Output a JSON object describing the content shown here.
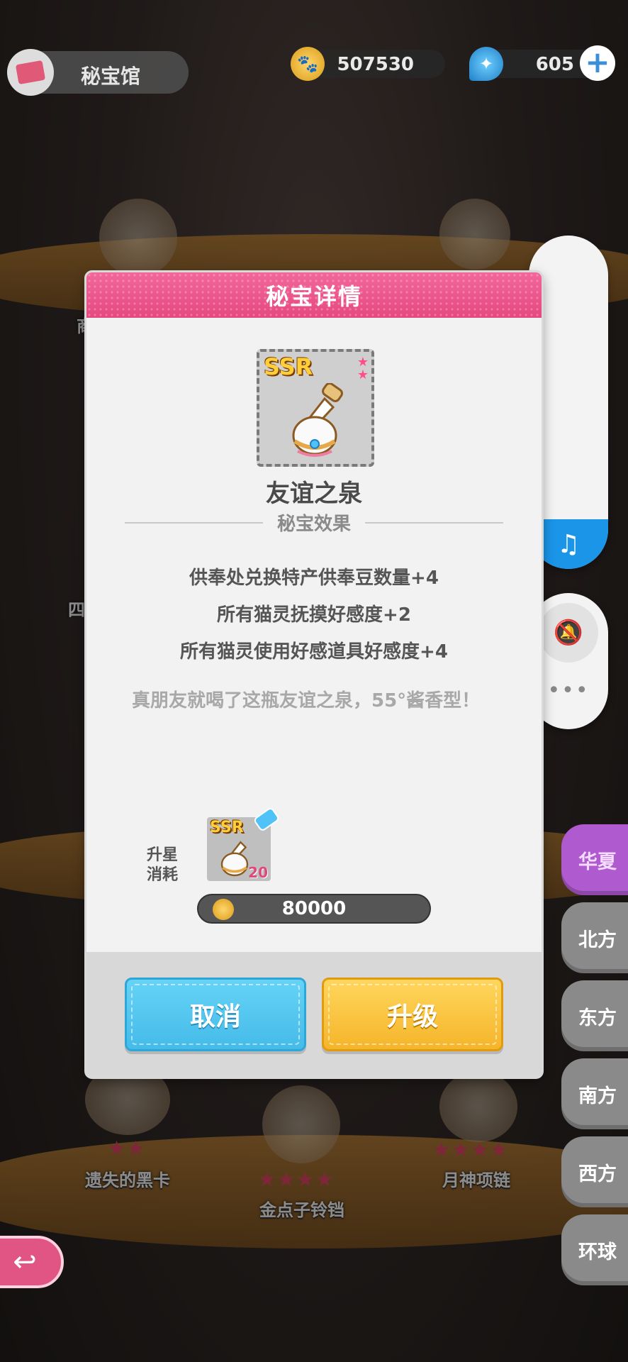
{
  "topbar": {
    "title": "秘宝馆",
    "coins": "507530",
    "gems": "605",
    "plus": "+"
  },
  "background": {
    "labels": [
      "遗失的黑卡",
      "金点子铃铛",
      "月神项链",
      "商",
      "四"
    ],
    "stars": [
      "★★",
      "★★★★",
      "★★★★"
    ]
  },
  "modal": {
    "title": "秘宝详情",
    "rarity": "SSR",
    "item_name": "友谊之泉",
    "section_title": "秘宝效果",
    "effects": [
      "供奉处兑换特产供奉豆数量+4",
      "所有猫灵抚摸好感度+2",
      "所有猫灵使用好感道具好感度+4"
    ],
    "flavor": "真朋友就喝了这瓶友谊之泉，55°酱香型！",
    "cost_label": "升星消耗",
    "cost_item_count": "20",
    "cost_coins": "80000",
    "cancel_label": "取消",
    "upgrade_label": "升级"
  },
  "regions": [
    "华夏",
    "北方",
    "东方",
    "南方",
    "西方",
    "环球"
  ],
  "active_region": "华夏",
  "colors": {
    "header_pink": "#e5487f",
    "cancel_blue": "#44bbe9",
    "upgrade_yellow": "#f5b52a",
    "region_active": "#b05ad0",
    "music_blue": "#1a95e8"
  },
  "icons": {
    "coin": "paw-coin-icon",
    "gem": "blue-gem-icon",
    "music": "music-note-icon",
    "bell": "bell-off-icon",
    "more": "more-dots-icon",
    "back": "back-arrow-icon"
  }
}
